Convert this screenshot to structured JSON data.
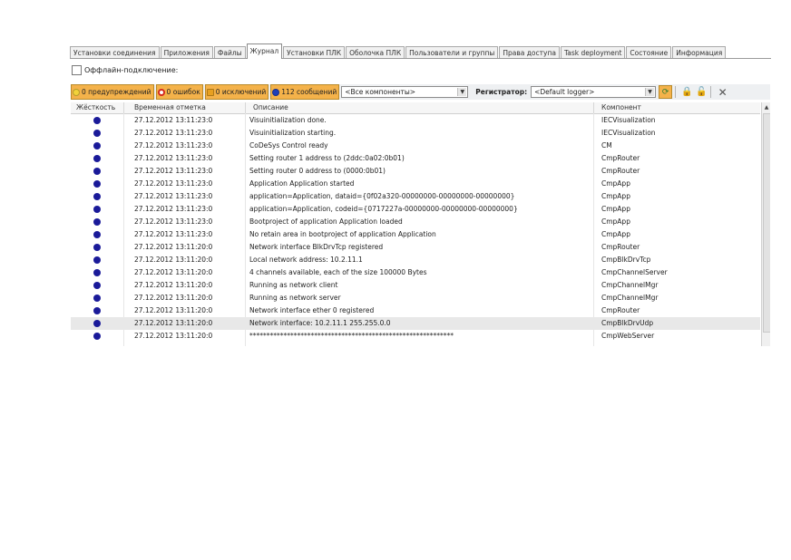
{
  "tabs": [
    {
      "label": "Установки соединения",
      "active": false
    },
    {
      "label": "Приложения",
      "active": false
    },
    {
      "label": "Файлы",
      "active": false
    },
    {
      "label": "Журнал",
      "active": true
    },
    {
      "label": "Установки ПЛК",
      "active": false
    },
    {
      "label": "Оболочка ПЛК",
      "active": false
    },
    {
      "label": "Пользователи и группы",
      "active": false
    },
    {
      "label": "Права доступа",
      "active": false
    },
    {
      "label": "Task deployment",
      "active": false
    },
    {
      "label": "Состояние",
      "active": false
    },
    {
      "label": "Информация",
      "active": false
    }
  ],
  "offline": {
    "label": "Оффлайн-подключение:",
    "checked": false
  },
  "toolbar": {
    "warnings": "0 предупреждений",
    "errors": "0 ошибок",
    "exceptions": "0 исключений",
    "messages": "112 сообщений",
    "component_filter": "<Все компоненты>",
    "logger_label": "Регистратор:",
    "logger_value": "<Default logger>"
  },
  "colors": {
    "warning": "#f2d23a",
    "error": "#d42a1f",
    "exception": "#e8a020",
    "message": "#1f3fb8",
    "accent": "#f4b24a"
  },
  "table": {
    "headers": [
      "Жёсткость",
      "Временная отметка",
      "Описание",
      "Компонент"
    ],
    "rows": [
      {
        "time": "27.12.2012 13:11:23:0",
        "desc": "Visuinitialization done.",
        "comp": "IECVisualization"
      },
      {
        "time": "27.12.2012 13:11:23:0",
        "desc": "Visuinitialization starting.",
        "comp": "IECVisualization"
      },
      {
        "time": "27.12.2012 13:11:23:0",
        "desc": "CoDeSys Control ready",
        "comp": "CM"
      },
      {
        "time": "27.12.2012 13:11:23:0",
        "desc": "Setting router 1 address to (2ddc:0a02:0b01)",
        "comp": "CmpRouter"
      },
      {
        "time": "27.12.2012 13:11:23:0",
        "desc": "Setting router 0 address to (0000:0b01)",
        "comp": "CmpRouter"
      },
      {
        "time": "27.12.2012 13:11:23:0",
        "desc": "Application Application started",
        "comp": "CmpApp"
      },
      {
        "time": "27.12.2012 13:11:23:0",
        "desc": "application=Application, dataid={0f02a320-00000000-00000000-00000000}",
        "comp": "CmpApp"
      },
      {
        "time": "27.12.2012 13:11:23:0",
        "desc": "application=Application, codeid={0717227a-00000000-00000000-00000000}",
        "comp": "CmpApp"
      },
      {
        "time": "27.12.2012 13:11:23:0",
        "desc": "Bootproject of application Application loaded",
        "comp": "CmpApp"
      },
      {
        "time": "27.12.2012 13:11:23:0",
        "desc": "No retain area in bootproject of application Application",
        "comp": "CmpApp"
      },
      {
        "time": "27.12.2012 13:11:20:0",
        "desc": "Network interface BlkDrvTcp registered",
        "comp": "CmpRouter"
      },
      {
        "time": "27.12.2012 13:11:20:0",
        "desc": "Local network address: 10.2.11.1",
        "comp": "CmpBlkDrvTcp"
      },
      {
        "time": "27.12.2012 13:11:20:0",
        "desc": "4 channels available, each of the size 100000 Bytes",
        "comp": "CmpChannelServer"
      },
      {
        "time": "27.12.2012 13:11:20:0",
        "desc": "Running as network client",
        "comp": "CmpChannelMgr"
      },
      {
        "time": "27.12.2012 13:11:20:0",
        "desc": "Running as network server",
        "comp": "CmpChannelMgr"
      },
      {
        "time": "27.12.2012 13:11:20:0",
        "desc": "Network interface ether 0 registered",
        "comp": "CmpRouter"
      },
      {
        "time": "27.12.2012 13:11:20:0",
        "desc": "Network interface: 10.2.11.1 255.255.0.0",
        "comp": "CmpBlkDrvUdp",
        "selected": true
      },
      {
        "time": "27.12.2012 13:11:20:0",
        "desc": "************************************************************",
        "comp": "CmpWebServer"
      }
    ]
  }
}
